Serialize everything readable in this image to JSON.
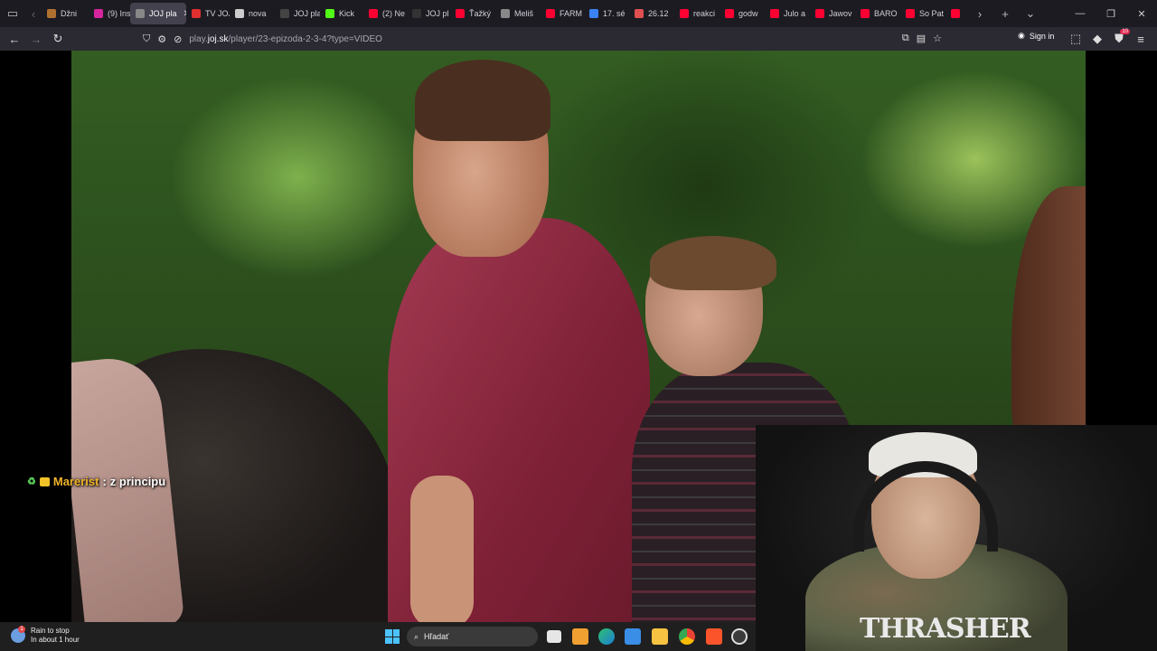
{
  "browser": {
    "tabs": [
      {
        "label": "Džni",
        "color": "#b07030",
        "active": false
      },
      {
        "label": "(9) Ins",
        "color": "#d6249f",
        "active": false
      },
      {
        "label": "JOJ pla",
        "color": "#888888",
        "active": true
      },
      {
        "label": "TV JOJ",
        "color": "#e03030",
        "active": false
      },
      {
        "label": "nova",
        "color": "#cccccc",
        "active": false
      },
      {
        "label": "JOJ play",
        "color": "#444444",
        "active": false
      },
      {
        "label": "Kick",
        "color": "#53fc18",
        "active": false
      },
      {
        "label": "(2) Ne",
        "color": "#ff0033",
        "active": false
      },
      {
        "label": "JOJ pl",
        "color": "#333333",
        "active": false
      },
      {
        "label": "Ťažký",
        "color": "#ff0033",
        "active": false
      },
      {
        "label": "Meliš",
        "color": "#888888",
        "active": false
      },
      {
        "label": "FARM",
        "color": "#ff0033",
        "active": false
      },
      {
        "label": "17. sé",
        "color": "#3b82f6",
        "active": false
      },
      {
        "label": "26.12",
        "color": "#e05050",
        "active": false
      },
      {
        "label": "reakci",
        "color": "#ff0033",
        "active": false
      },
      {
        "label": "godw",
        "color": "#ff0033",
        "active": false
      },
      {
        "label": "Julo a",
        "color": "#ff0033",
        "active": false
      },
      {
        "label": "Jawov",
        "color": "#ff0033",
        "active": false
      },
      {
        "label": "BARO",
        "color": "#ff0033",
        "active": false
      },
      {
        "label": "So Pat",
        "color": "#ff0033",
        "active": false
      },
      {
        "label": "",
        "color": "#ff0033",
        "active": false
      }
    ],
    "url": {
      "prefix": "play.",
      "domain": "joj.sk",
      "path": "/player/23-epizoda-2-3-4?type=VIDEO"
    },
    "sign_in": "Sign in",
    "extension_badge": "10"
  },
  "chat": {
    "username": "Marerist",
    "separator": " : ",
    "message": "z principu"
  },
  "webcam": {
    "shirt_text": "THRASHER"
  },
  "taskbar": {
    "weather_title": "Rain to stop",
    "weather_sub": "In about 1 hour",
    "weather_badge": "1",
    "search_placeholder": "Hľadať"
  }
}
